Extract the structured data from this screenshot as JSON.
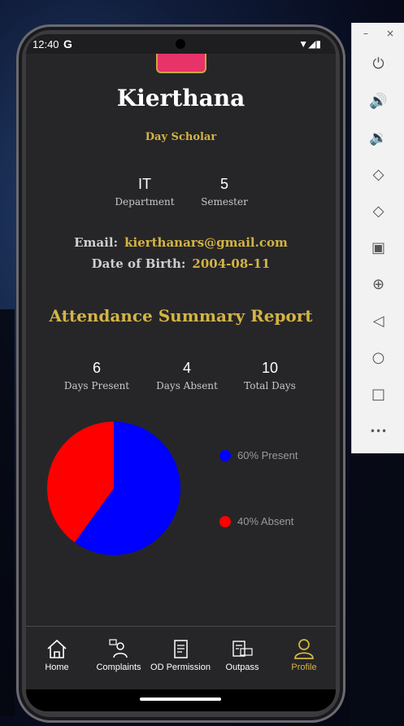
{
  "status_bar": {
    "time": "12:40",
    "g_label": "G",
    "icons_text": "▼◢▮"
  },
  "profile": {
    "name": "Kierthana",
    "scholar_type": "Day Scholar",
    "department_value": "IT",
    "department_label": "Department",
    "semester_value": "5",
    "semester_label": "Semester",
    "email_label": "Email:",
    "email_value": "kierthanars@gmail.com",
    "dob_label": "Date of Birth:",
    "dob_value": "2004-08-11"
  },
  "attendance": {
    "title": "Attendance Summary Report",
    "present_value": "6",
    "present_label": "Days Present",
    "absent_value": "4",
    "absent_label": "Days Absent",
    "total_value": "10",
    "total_label": "Total Days",
    "legend_present": "60% Present",
    "legend_absent": "40% Absent"
  },
  "chart_data": {
    "type": "pie",
    "categories": [
      "Present",
      "Absent"
    ],
    "values": [
      60,
      40
    ],
    "colors": [
      "#0000ff",
      "#ff0000"
    ],
    "legend_position": "right"
  },
  "nav": {
    "items": [
      {
        "label": "Home",
        "icon": "home-icon"
      },
      {
        "label": "Complaints",
        "icon": "complaints-icon"
      },
      {
        "label": "OD Permission",
        "icon": "od-permission-icon"
      },
      {
        "label": "Outpass",
        "icon": "outpass-icon"
      },
      {
        "label": "Profile",
        "icon": "profile-icon"
      }
    ],
    "active_color": "#d4b443"
  },
  "emulator_panel": {
    "minimize": "–",
    "close": "×",
    "more": "•••"
  }
}
